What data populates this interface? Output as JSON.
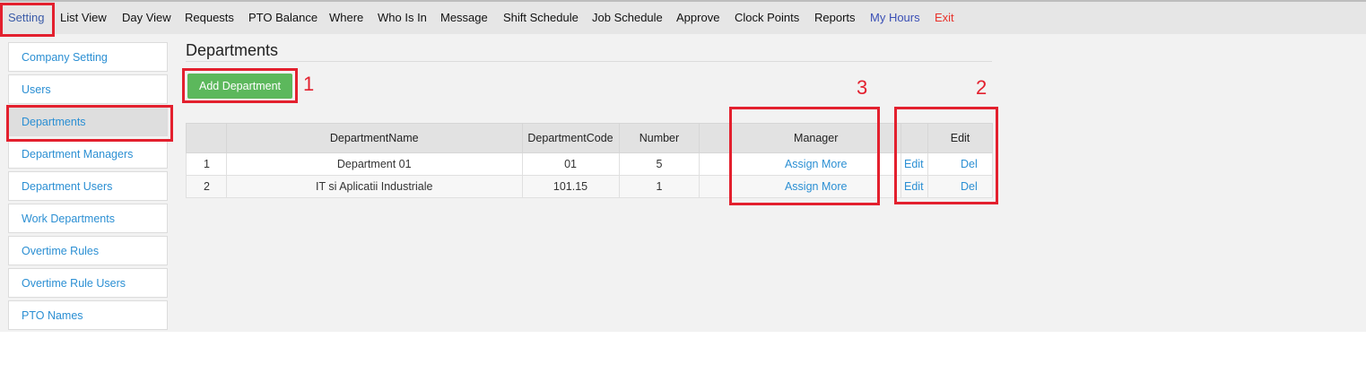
{
  "nav": {
    "items": [
      {
        "label": "Setting"
      },
      {
        "label": "List View"
      },
      {
        "label": "Day View"
      },
      {
        "label": "Requests"
      },
      {
        "label": "PTO Balance"
      },
      {
        "label": "Where"
      },
      {
        "label": "Who Is In"
      },
      {
        "label": "Message"
      },
      {
        "label": "Shift Schedule"
      },
      {
        "label": "Job Schedule"
      },
      {
        "label": "Approve"
      },
      {
        "label": "Clock Points"
      },
      {
        "label": "Reports"
      },
      {
        "label": "My Hours"
      },
      {
        "label": "Exit"
      }
    ]
  },
  "sidebar": {
    "items": [
      {
        "label": "Company Setting"
      },
      {
        "label": "Users"
      },
      {
        "label": "Departments"
      },
      {
        "label": "Department Managers"
      },
      {
        "label": "Department Users"
      },
      {
        "label": "Work Departments"
      },
      {
        "label": "Overtime Rules"
      },
      {
        "label": "Overtime Rule Users"
      },
      {
        "label": "PTO Names"
      }
    ]
  },
  "main": {
    "title": "Departments",
    "add_button": "Add Department",
    "annotations": [
      "1",
      "2",
      "3"
    ],
    "table": {
      "headers": [
        "",
        "DepartmentName",
        "DepartmentCode",
        "Number",
        "",
        "Manager",
        "",
        "Edit"
      ],
      "rows": [
        {
          "idx": "1",
          "name": "Department 01",
          "code": "01",
          "number": "5",
          "manager_link": "Assign More",
          "edit": "Edit",
          "del": "Del"
        },
        {
          "idx": "2",
          "name": "IT si Aplicatii Industriale",
          "code": "101.15",
          "number": "1",
          "manager_link": "Assign More",
          "edit": "Edit",
          "del": "Del"
        }
      ]
    }
  },
  "colors": {
    "link": "#2b8fd3",
    "add_button_bg": "#5cb85c",
    "highlight_red": "#e3202e",
    "exit": "#e8322b",
    "my_hours": "#3a4fb5"
  }
}
